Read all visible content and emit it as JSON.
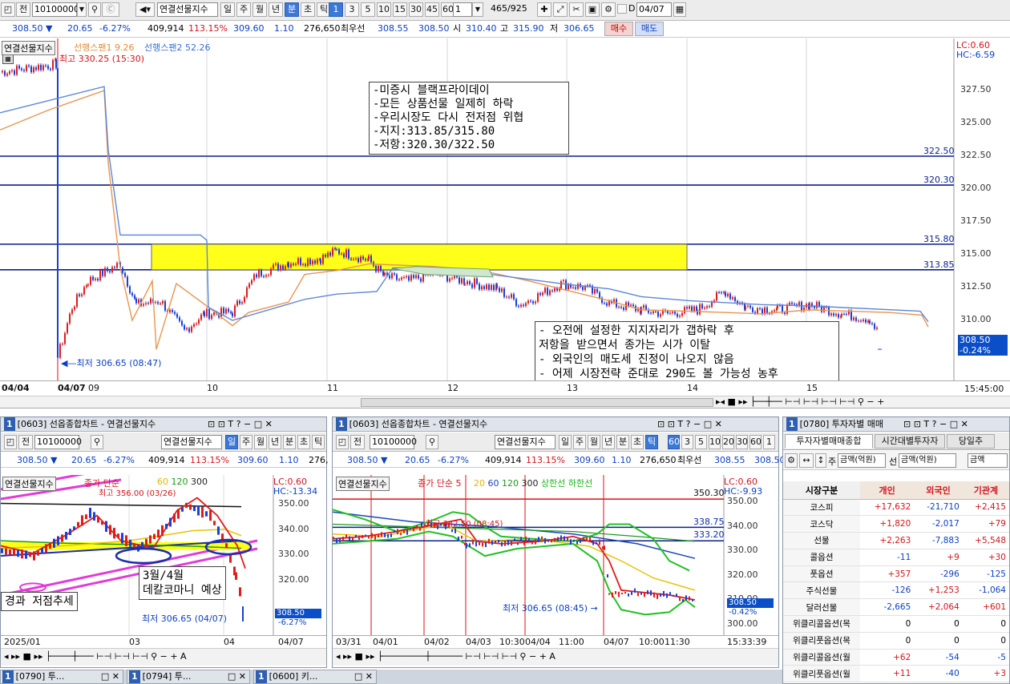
{
  "top": {
    "toolbar": {
      "jeon": "전",
      "code": "10100000",
      "name": "연결선물지수",
      "periods": [
        "일",
        "주",
        "월",
        "년",
        "분",
        "초",
        "틱"
      ],
      "selected_period": "분",
      "intervals": [
        "1",
        "3",
        "5",
        "10",
        "15",
        "30",
        "45",
        "60"
      ],
      "selected_interval": "1",
      "count": "1",
      "range": "465/925",
      "d_label": "D",
      "date": "04/07"
    },
    "quote": {
      "price": "308.50 ▼",
      "change": "20.65",
      "pct": "-6.27%",
      "volume": "409,914",
      "vol_pct": "113.15%",
      "prev": "309.60",
      "diff": "1.10",
      "oi": "276,650",
      "best_label": "최우선",
      "ask": "308.55",
      "bid": "308.50",
      "open_label": "시",
      "open": "310.40",
      "high_label": "고",
      "high": "315.90",
      "low_label": "저",
      "low": "306.65",
      "buy": "매수",
      "sell": "매도"
    },
    "chart": {
      "legend_main": "연결선물지수",
      "legend_span1": "선행스팬1 9.26",
      "legend_span2": "선행스팬2 52.26",
      "max_label": "최고 330.25 (15:30)",
      "min_label": "최저 306.65 (08:47)",
      "lc": "LC:0.60",
      "hc": "HC:-6.59",
      "yticks": [
        "327.50",
        "325.00",
        "322.50",
        "320.00",
        "317.50",
        "315.00",
        "312.50",
        "310.00"
      ],
      "hlines": [
        "322.50",
        "320.30",
        "315.80",
        "313.85"
      ],
      "current_price": "308.50",
      "current_pct": "-0.24%",
      "time": "15:45:00",
      "xlabels": [
        "04/04",
        "04/07",
        "09",
        "10",
        "11",
        "12",
        "13",
        "14",
        "15"
      ],
      "note1": "-미증시 블랙프라이데이\n-모든 상품선물 일제히 하락\n-우리시장도 다시 전저점 위협\n-지지:313.85/315.80\n-저항:320.30/322.50",
      "note2": "- 오전에 설정한 지지자리가 갭하락 후\n저항을 받으면서 종가는 시가 이탈\n- 외국인의 매도세 진정이 나오지 않음\n- 어제 시장전략 준대로 290도 볼 가능성 농후"
    }
  },
  "left_panel": {
    "title_num": "1",
    "title": "[0603] 선옵종합차트 - 연결선물지수",
    "code": "10100000",
    "name": "연결선물지수",
    "periods": [
      "일",
      "주",
      "월",
      "년",
      "분",
      "초",
      "틱"
    ],
    "quote": [
      "308.50 ▼",
      "20.65",
      "-6.27%",
      "409,914",
      "113.15%",
      "309.60",
      "1.10",
      "276,"
    ],
    "legend": "연결선물지수",
    "legend2": "종가 단순",
    "legend_nums": [
      "60",
      "120",
      "300"
    ],
    "max_label": "최고 356.00 (03/26)",
    "lc": "LC:0.60",
    "hc": "HC:-13.34",
    "yticks": [
      "350.00",
      "340.00",
      "330.00",
      "320.00"
    ],
    "price": "308.50",
    "pct": "-6.27%",
    "note_a": "3월/4월\n데칼코마니 예상",
    "note_b": "경과 저점추세",
    "min_label": "최저 306.65 (04/07)",
    "xlabels": [
      "2025/01",
      "03",
      "04",
      "04/07"
    ]
  },
  "mid_panel": {
    "title_num": "1",
    "title": "[0603] 선옵종합차트 - 연결선물지수",
    "code": "10100000",
    "name": "연결선물지수",
    "periods": [
      "일",
      "주",
      "월",
      "년",
      "분",
      "초",
      "틱"
    ],
    "ticks": [
      "600",
      "3",
      "5",
      "10",
      "20",
      "30",
      "60",
      "1"
    ],
    "quote": [
      "308.50 ▼",
      "20.65",
      "-6.27%",
      "409,914",
      "113.15%",
      "309.60",
      "1.10",
      "276,650",
      "최우선",
      "308.55",
      "308.50"
    ],
    "legend": "연결선물지수",
    "legend2": "종가 단순 5",
    "legend_nums": [
      "20",
      "60",
      "120",
      "300"
    ],
    "legend_band": "상한선 하한선",
    "max_label": "최고 342.50 (08:45)",
    "lc": "LC:0.60",
    "hc": "HC:-9.93",
    "yticks": [
      "350.00",
      "340.00",
      "330.00",
      "320.00",
      "310.00",
      "300.00"
    ],
    "hline_labels": [
      "350.30",
      "338.75",
      "333.20"
    ],
    "price": "308.50",
    "pct": "-0.42%",
    "min_label": "최저 306.65 (08:45)",
    "xlabels": [
      "03/31",
      "04/01",
      "04/02",
      "04/03",
      "10:30",
      "04/04",
      "11:00",
      "04/07",
      "10:00",
      "11:30",
      "15:33:39"
    ]
  },
  "right_panel": {
    "title_num": "1",
    "title": "[0780] 투자자별 매매",
    "tabs": [
      "투자자별매매종합",
      "시간대별투자자",
      "당일추"
    ],
    "unit_label": "주",
    "unit1": "금액(억원)",
    "label_2": "선",
    "unit2": "금액(억원)",
    "unit3": "금액",
    "headers": [
      "시장구분",
      "개인",
      "외국인",
      "기관계"
    ],
    "rows": [
      [
        "코스피",
        "+17,632",
        "-21,710",
        "+2,415"
      ],
      [
        "코스닥",
        "+1,820",
        "-2,017",
        "+79"
      ],
      [
        "선물",
        "+2,263",
        "-7,883",
        "+5,548"
      ],
      [
        "콜옵션",
        "-11",
        "+9",
        "+30"
      ],
      [
        "풋옵션",
        "+357",
        "-296",
        "-125"
      ],
      [
        "주식선물",
        "-126",
        "+1,253",
        "-1,064"
      ],
      [
        "달러선물",
        "-2,665",
        "+2,064",
        "+601"
      ],
      [
        "위클리콜옵션(목",
        "0",
        "0",
        "0"
      ],
      [
        "위클리풋옵션(목",
        "0",
        "0",
        "0"
      ],
      [
        "위클리콜옵션(월",
        "+62",
        "-54",
        "-5"
      ],
      [
        "위클리풋옵션(월",
        "+11",
        "-40",
        "+3"
      ]
    ]
  },
  "taskbar": [
    {
      "num": "1",
      "label": "[0790] 투..."
    },
    {
      "num": "1",
      "label": "[0794] 투..."
    },
    {
      "num": "1",
      "label": "[0600] 키..."
    }
  ]
}
